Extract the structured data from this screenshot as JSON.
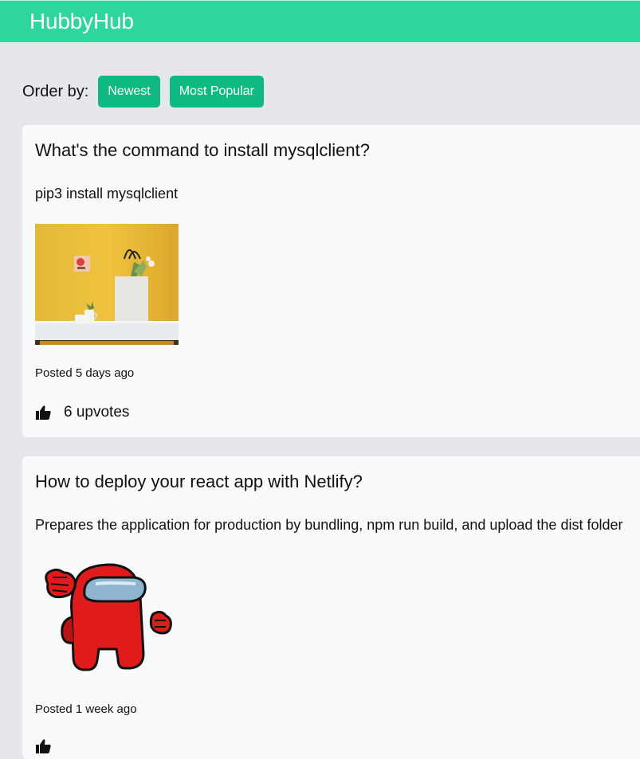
{
  "header": {
    "brand": "HubbyHub"
  },
  "sort": {
    "label": "Order by:",
    "options": [
      "Newest",
      "Most Popular"
    ]
  },
  "posts": [
    {
      "title": "What's the command to install mysqlclient?",
      "body": "pip3 install mysqlclient",
      "image_icon": "yellow-room-tote-bag-photo",
      "posted": "Posted 5 days ago",
      "upvotes": "6 upvotes",
      "upvote_icon": "thumbs-up-icon"
    },
    {
      "title": "How to deploy your react app with Netlify?",
      "body": "Prepares the application for production by bundling, npm run build, and upload the dist folder",
      "image_icon": "red-among-us-crewmate-sticker",
      "posted": "Posted 1 week ago",
      "upvote_icon": "thumbs-up-icon"
    }
  ],
  "colors": {
    "header_bg": "#2ed69d",
    "button_bg": "#10b981",
    "page_bg": "#e5e7eb",
    "card_bg": "#f9fafb"
  }
}
